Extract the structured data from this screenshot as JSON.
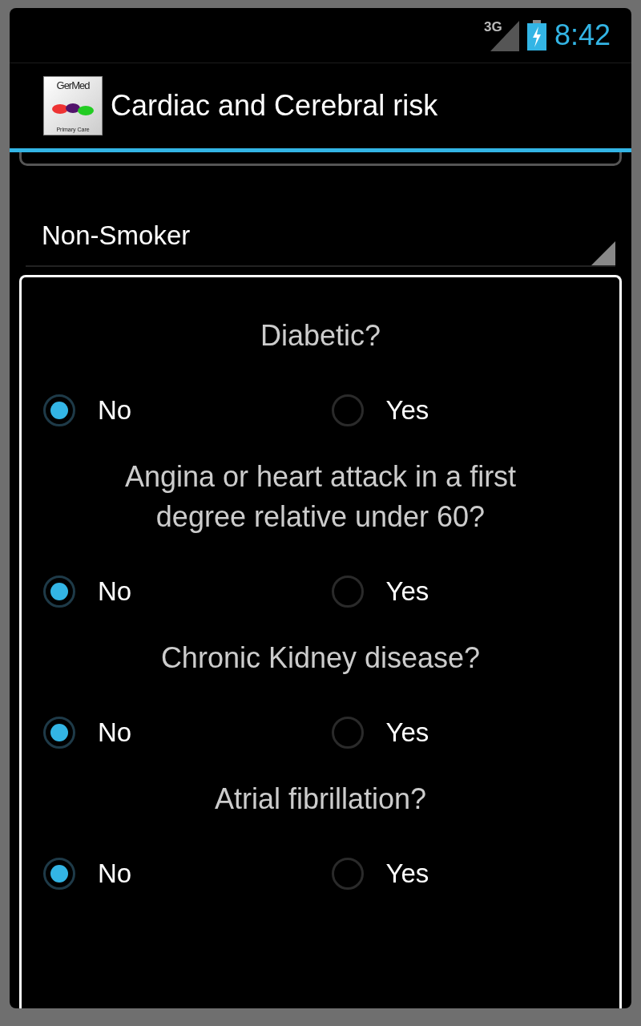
{
  "status_bar": {
    "network": "3G",
    "time": "8:42"
  },
  "action_bar": {
    "logo": {
      "top_text": "GerMed",
      "bottom_text": "Primary Care"
    },
    "title": "Cardiac and Cerebral risk"
  },
  "smoking_spinner": {
    "value": "Non-Smoker"
  },
  "questions": [
    {
      "text": "Diabetic?",
      "options": [
        {
          "label": "No",
          "selected": true
        },
        {
          "label": "Yes",
          "selected": false
        }
      ]
    },
    {
      "text": "Angina or heart attack in a first degree relative under 60?",
      "options": [
        {
          "label": "No",
          "selected": true
        },
        {
          "label": "Yes",
          "selected": false
        }
      ]
    },
    {
      "text": "Chronic Kidney disease?",
      "options": [
        {
          "label": "No",
          "selected": true
        },
        {
          "label": "Yes",
          "selected": false
        }
      ]
    },
    {
      "text": "Atrial fibrillation?",
      "options": [
        {
          "label": "No",
          "selected": true
        },
        {
          "label": "Yes",
          "selected": false
        }
      ]
    }
  ]
}
